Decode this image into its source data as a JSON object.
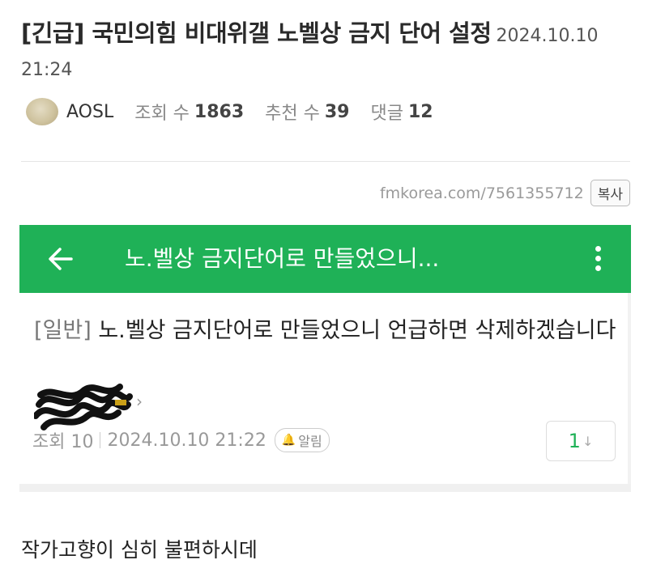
{
  "post": {
    "title": "[긴급] 국민의힘 비대위갤 노벨상 금지 단어 설정",
    "date": "2024.10.10 21:24",
    "author": "AOSL",
    "views_label": "조회 수",
    "views": "1863",
    "recommends_label": "추천 수",
    "recommends": "39",
    "comments_label": "댓글",
    "comments": "12",
    "url": "fmkorea.com/7561355712",
    "copy_label": "복사",
    "body": "작가고향이 심히 불편하시데"
  },
  "screenshot": {
    "bar_title": "노.벨상 금지단어로 만들었으니...",
    "category": "[일반]",
    "title": "노.벨상 금지단어로 만들었으니 언급하면 삭제하겠습니다",
    "views_text": "조회 10",
    "date": "2024.10.10 21:22",
    "alarm_label": "알림",
    "vote_count": "1",
    "vote_arrow": "↓",
    "chevron": "›",
    "accent_color": "#1fb157"
  },
  "icons": {
    "back": "arrow-left-icon",
    "more": "more-vertical-icon",
    "bell": "bell-icon"
  }
}
